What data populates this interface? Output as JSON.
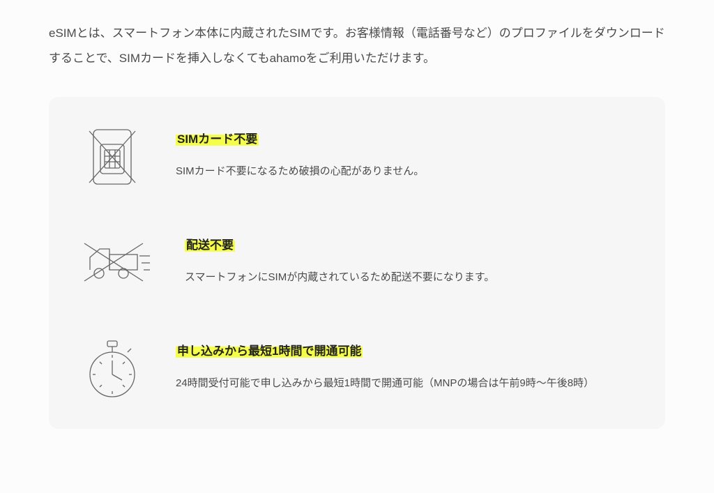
{
  "intro": "eSIMとは、スマートフォン本体に内蔵されたSIMです。お客様情報（電話番号など）のプロファイルをダウンロードすることで、SIMカードを挿入しなくてもahamoをご利用いただけます。",
  "features": [
    {
      "title": "SIMカード不要",
      "desc": "SIMカード不要になるため破損の心配がありません。"
    },
    {
      "title": "配送不要",
      "desc": "スマートフォンにSIMが内蔵されているため配送不要になります。"
    },
    {
      "title": "申し込みから最短1時間で開通可能",
      "desc": "24時間受付可能で申し込みから最短1時間で開通可能（MNPの場合は午前9時～午後8時）"
    }
  ]
}
